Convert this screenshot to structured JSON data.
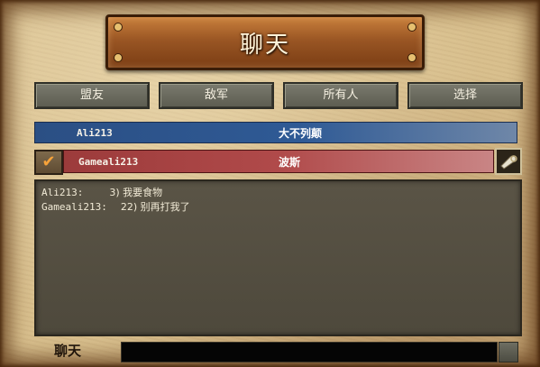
{
  "window": {
    "title": "聊天"
  },
  "tabs": [
    {
      "label": "盟友"
    },
    {
      "label": "敌军"
    },
    {
      "label": "所有人"
    },
    {
      "label": "选择"
    }
  ],
  "players": [
    {
      "name": "Ali213",
      "civilization": "大不列颠",
      "row_color": "#2f5a95",
      "checked": false
    },
    {
      "name": "Gameali213",
      "civilization": "波斯",
      "row_color": "#b04a4a",
      "checked": true
    }
  ],
  "messages": [
    {
      "sender": "Ali213:",
      "text": "3) 我要食物"
    },
    {
      "sender": "Gameali213:",
      "text": "22) 别再打我了"
    }
  ],
  "chat_input": {
    "label": "聊天",
    "value": ""
  },
  "icons": {
    "checkbox": "check-icon",
    "horn": "horn-icon"
  }
}
